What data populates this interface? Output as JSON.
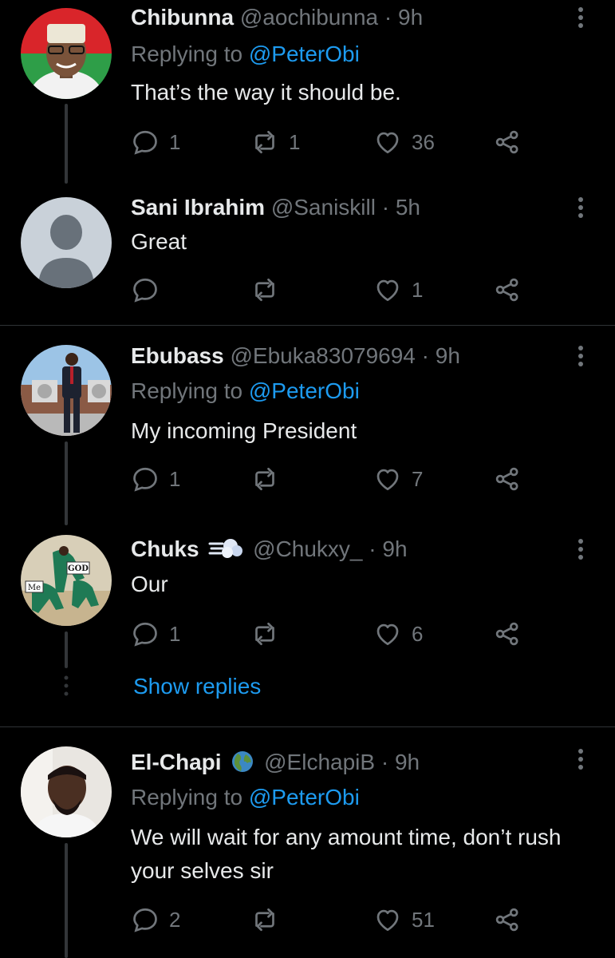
{
  "tweets": [
    {
      "name": "Chibunna",
      "handle": "@aochibunna",
      "time": "9h",
      "replying_label": "Replying to",
      "replying_to": "@PeterObi",
      "text": "That’s the way it should be.",
      "replies": "1",
      "retweets": "1",
      "likes": "36"
    },
    {
      "name": "Sani Ibrahim",
      "handle": "@Saniskill",
      "time": "5h",
      "text": "Great",
      "replies": "",
      "retweets": "",
      "likes": "1"
    },
    {
      "name": "Ebubass",
      "handle": "@Ebuka83079694",
      "time": "9h",
      "replying_label": "Replying to",
      "replying_to": "@PeterObi",
      "text": "My incoming President",
      "replies": "1",
      "retweets": "",
      "likes": "7"
    },
    {
      "name": "Chuks",
      "emoji": "dash-emoji",
      "handle": "@Chukxy_",
      "time": "9h",
      "text": "Our",
      "replies": "1",
      "retweets": "",
      "likes": "6",
      "avatar_labels": [
        "GOD",
        "Me"
      ]
    },
    {
      "name": "El-Chapi",
      "emoji": "globe-emoji",
      "handle": "@ElchapiB",
      "time": "9h",
      "replying_label": "Replying to",
      "replying_to": "@PeterObi",
      "text": "We will wait for any amount time, don’t rush your selves sir",
      "replies": "2",
      "retweets": "",
      "likes": "51"
    }
  ],
  "separator": "·",
  "show_replies": "Show replies",
  "colors": {
    "background": "#000000",
    "primary_text": "#e7e9ea",
    "secondary_text": "#71767b",
    "link": "#1d9bf0",
    "divider": "#2f3336"
  }
}
